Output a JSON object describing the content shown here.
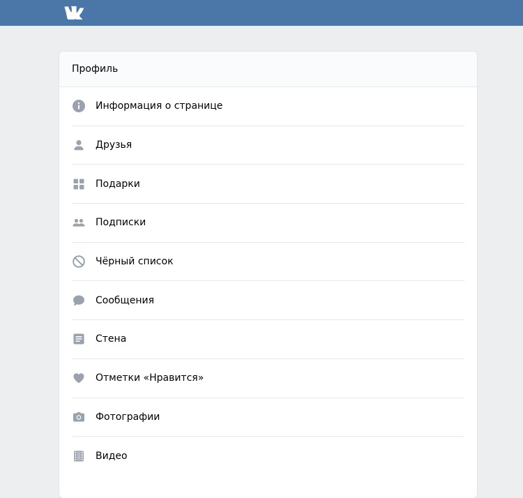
{
  "header": {
    "logo_text": "VK",
    "background_color": "#4a76a8"
  },
  "card": {
    "title": "Профиль",
    "items": [
      {
        "label": "Информация о странице",
        "icon": "info-icon"
      },
      {
        "label": "Друзья",
        "icon": "user-icon"
      },
      {
        "label": "Подарки",
        "icon": "gift-icon"
      },
      {
        "label": "Подписки",
        "icon": "users-icon"
      },
      {
        "label": "Чёрный список",
        "icon": "block-icon"
      },
      {
        "label": "Сообщения",
        "icon": "message-icon"
      },
      {
        "label": "Стена",
        "icon": "wall-icon"
      },
      {
        "label": "Отметки «Нравится»",
        "icon": "heart-icon"
      },
      {
        "label": "Фотографии",
        "icon": "camera-icon"
      },
      {
        "label": "Видео",
        "icon": "video-icon"
      }
    ]
  },
  "colors": {
    "icon": "#99a2ad",
    "page_background": "#edeef0",
    "divider": "#e7e8ec"
  }
}
